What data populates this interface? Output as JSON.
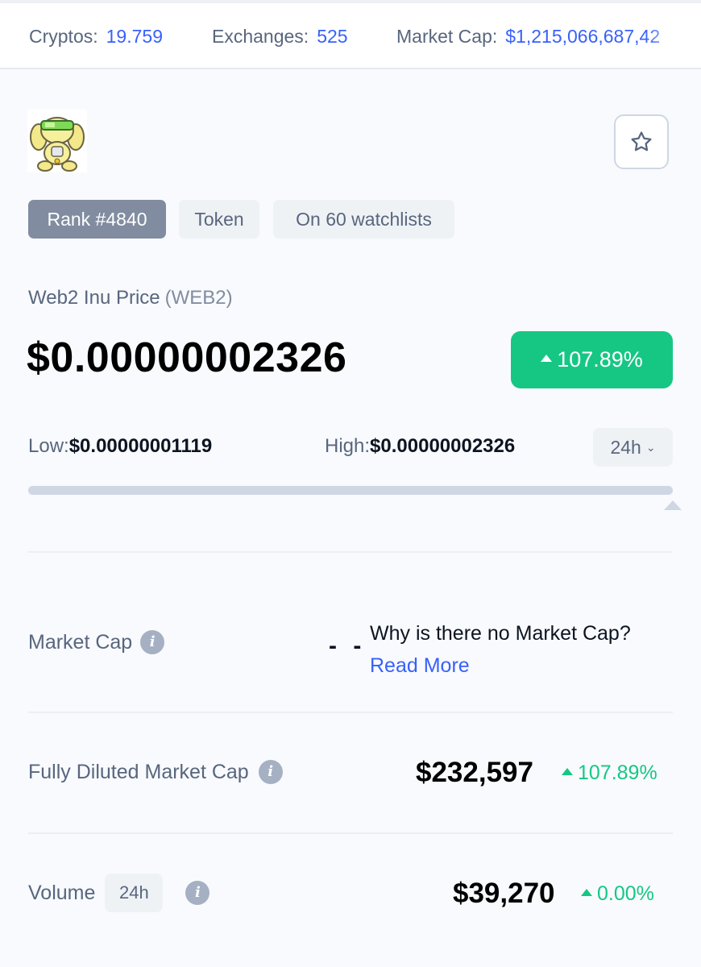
{
  "stats_bar": {
    "cryptos_label": "Cryptos:",
    "cryptos_value": "19.759",
    "exchanges_label": "Exchanges:",
    "exchanges_value": "525",
    "market_cap_label": "Market Cap:",
    "market_cap_value": "$1,215,066,687,42"
  },
  "coin": {
    "logo_icon": "web2-inu-dog-logo",
    "watchlist_icon": "star-outline-icon",
    "tags": {
      "rank": "Rank #4840",
      "type": "Token",
      "watchlists": "On 60 watchlists"
    },
    "price_label": "Web2 Inu Price",
    "symbol": "(WEB2)",
    "price": "$0.00000002326",
    "change_24h": "107.89%",
    "low_label": "Low:",
    "low_value": "$0.00000001119",
    "high_label": "High:",
    "high_value": "$0.00000002326",
    "period": "24h",
    "range_position_fraction": 1.0
  },
  "stats": {
    "market_cap": {
      "label": "Market Cap",
      "value": "- -",
      "why_text": "Why is there no Market Cap?",
      "read_more": "Read More"
    },
    "fdmc": {
      "label": "Fully Diluted Market Cap",
      "value": "$232,597",
      "change": "107.89%"
    },
    "volume": {
      "label": "Volume",
      "period": "24h",
      "value": "$39,270",
      "change": "0.00%"
    }
  },
  "colors": {
    "accent_blue": "#3861fb",
    "positive_green": "#16c784",
    "muted_text": "#58667e"
  }
}
